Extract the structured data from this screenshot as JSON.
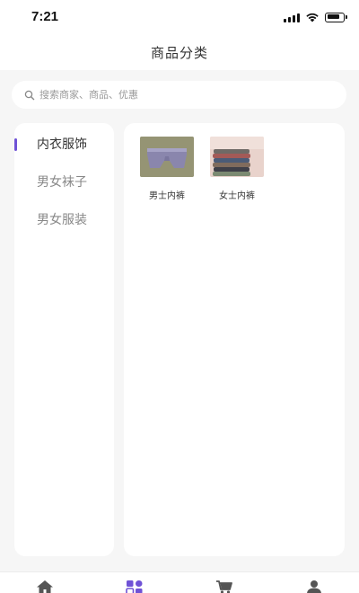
{
  "status_bar": {
    "time": "7:21"
  },
  "header": {
    "title": "商品分类"
  },
  "search": {
    "placeholder": "搜索商家、商品、优惠"
  },
  "categories": {
    "items": [
      {
        "label": "内衣服饰",
        "active": true
      },
      {
        "label": "男女袜子",
        "active": false
      },
      {
        "label": "男女服装",
        "active": false
      }
    ]
  },
  "products": [
    {
      "name": "男士内裤",
      "thumbnail": "mens-underwear-image"
    },
    {
      "name": "女士内裤",
      "thumbnail": "womens-underwear-image"
    }
  ],
  "tab_bar": {
    "tabs": [
      {
        "icon": "home-icon",
        "active": false
      },
      {
        "icon": "category-icon",
        "active": true
      },
      {
        "icon": "cart-icon",
        "active": false
      },
      {
        "icon": "user-icon",
        "active": false
      }
    ]
  },
  "colors": {
    "accent": "#6f52d6",
    "background": "#f6f6f6",
    "panel": "#ffffff"
  }
}
